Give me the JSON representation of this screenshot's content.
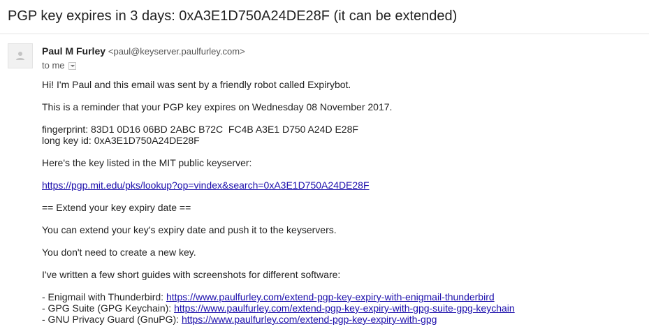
{
  "email": {
    "subject": "PGP key expires in 3 days: 0xA3E1D750A24DE28F (it can be extended)",
    "sender_name": "Paul M Furley",
    "sender_email": "<paul@keyserver.paulfurley.com>",
    "recipient": "to me",
    "body": {
      "greeting": "Hi! I'm Paul and this email was sent by a friendly robot called Expirybot.",
      "reminder": "This is a reminder that your PGP key expires on Wednesday 08 November 2017.",
      "fingerprint": "fingerprint: 83D1 0D16 06BD 2ABC B72C  FC4B A3E1 D750 A24D E28F",
      "long_key_id": "long key id: 0xA3E1D750A24DE28F",
      "key_listed": "Here's the key listed in the MIT public keyserver:",
      "keyserver_link": "https://pgp.mit.edu/pks/lookup?op=vindex&search=0xA3E1D750A24DE28F",
      "extend_heading": "== Extend your key expiry date ==",
      "extend_info": "You can extend your key's expiry date and push it to the keyservers.",
      "no_new_key": "You don't need to create a new key.",
      "guides_intro": "I've written a few short guides with screenshots for different software:",
      "guides": [
        {
          "label": "- Enigmail with Thunderbird: ",
          "link": "https://www.paulfurley.com/extend-pgp-key-expiry-with-enigmail-thunderbird"
        },
        {
          "label": "- GPG Suite (GPG Keychain): ",
          "link": "https://www.paulfurley.com/extend-pgp-key-expiry-with-gpg-suite-gpg-keychain"
        },
        {
          "label": "- GNU Privacy Guard (GnuPG): ",
          "link": "https://www.paulfurley.com/extend-pgp-key-expiry-with-gpg"
        }
      ]
    }
  },
  "icons": {
    "avatar": "person-icon",
    "details": "chevron-down-icon"
  },
  "colors": {
    "link": "#1a0dab",
    "text": "#222222",
    "muted": "#555555"
  }
}
